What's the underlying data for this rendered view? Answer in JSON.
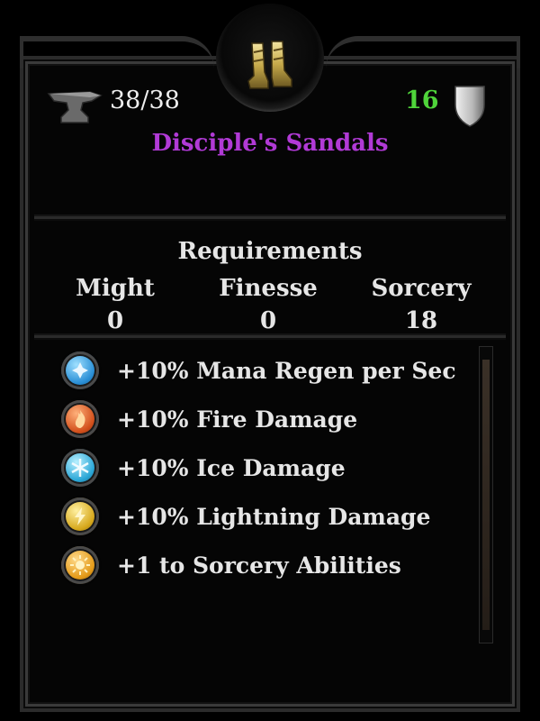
{
  "item": {
    "durability": "38/38",
    "armor": "16",
    "name": "Disciple's Sandals",
    "name_color": "#b13ad6",
    "armor_color": "#4fd43a",
    "icon": "boots-icon"
  },
  "requirements": {
    "title": "Requirements",
    "stats": [
      {
        "name": "Might",
        "value": "0"
      },
      {
        "name": "Finesse",
        "value": "0"
      },
      {
        "name": "Sorcery",
        "value": "18"
      }
    ]
  },
  "bonuses": [
    {
      "text": "+10% Mana Regen per Sec",
      "icon": "mana-regen-icon",
      "color": "#2a8fd6"
    },
    {
      "text": "+10% Fire Damage",
      "icon": "fire-icon",
      "color": "#d2501c"
    },
    {
      "text": "+10% Ice Damage",
      "icon": "ice-icon",
      "color": "#2aa6d6"
    },
    {
      "text": "+10% Lightning Damage",
      "icon": "lightning-icon",
      "color": "#d6a81c"
    },
    {
      "text": "+1 to Sorcery Abilities",
      "icon": "sorcery-icon",
      "color": "#e39a18"
    }
  ]
}
